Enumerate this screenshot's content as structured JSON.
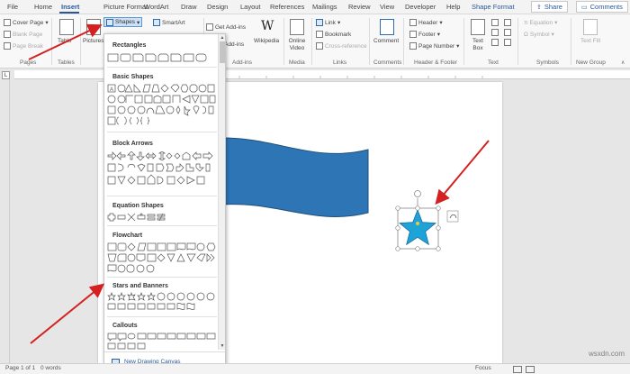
{
  "tabs": [
    "File",
    "Home",
    "Insert",
    "Picture Format",
    "WordArt",
    "Draw",
    "Design",
    "Layout",
    "References",
    "Mailings",
    "Review",
    "View",
    "Developer",
    "Help",
    "Shape Format"
  ],
  "share_label": "Share",
  "comments_label": "Comments",
  "ribbon": {
    "pages": {
      "cover_page": "Cover Page",
      "blank_page": "Blank Page",
      "page_break": "Page Break",
      "group": "Pages"
    },
    "tables": {
      "table": "Table",
      "group": "Tables"
    },
    "illustrations": {
      "pictures": "Pictures",
      "shapes": "Shapes",
      "smartart": "SmartArt"
    },
    "addins": {
      "get_addins": "Get Add-ins",
      "my_addins": "My Add-ins",
      "wikipedia": "Wikipedia",
      "group": "Add-ins"
    },
    "media": {
      "online_video": "Online Video",
      "group": "Media"
    },
    "links": {
      "link": "Link",
      "bookmark": "Bookmark",
      "cross_reference": "Cross-reference",
      "group": "Links"
    },
    "comments": {
      "comment": "Comment",
      "group": "Comments"
    },
    "header_footer": {
      "header": "Header",
      "footer": "Footer",
      "page_number": "Page Number",
      "group": "Header & Footer"
    },
    "text": {
      "text_box": "Text Box",
      "group": "Text"
    },
    "symbols": {
      "equation": "Equation",
      "symbol": "Symbol",
      "group": "Symbols"
    },
    "new_group": {
      "text_fill": "Text Fill",
      "group": "New Group"
    }
  },
  "shapes_menu": {
    "categories": [
      "Rectangles",
      "Basic Shapes",
      "Block Arrows",
      "Equation Shapes",
      "Flowchart",
      "Stars and Banners",
      "Callouts"
    ],
    "new_canvas": "New Drawing Canvas"
  },
  "status": {
    "page": "Page 1 of 1",
    "words": "0 words",
    "focus": "Focus"
  },
  "watermark": "wsxdn.com",
  "colors": {
    "accent": "#2b579a",
    "wave": "#2e75b6",
    "star": "#1ea3d8",
    "arrow": "#d42020"
  }
}
